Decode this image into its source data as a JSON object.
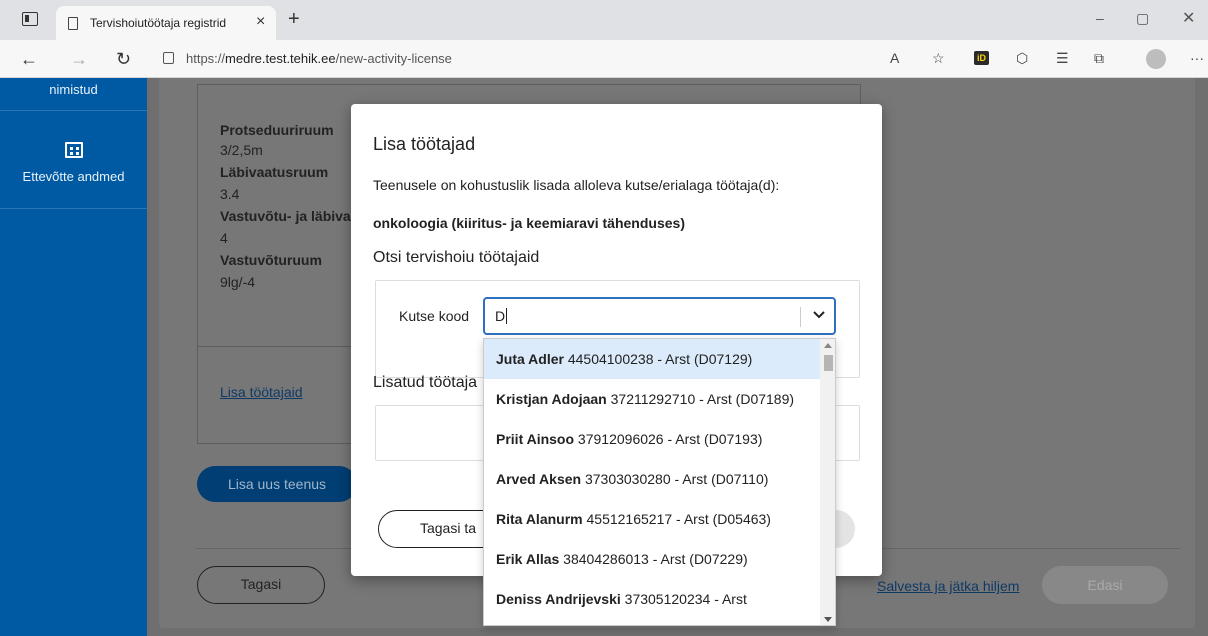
{
  "browser": {
    "tab_title": "Tervishoiutöötaja registrid",
    "tab_close": "×",
    "new_tab": "+",
    "url_prefix": "https://",
    "url_host": "medre.test.tehik.ee",
    "url_path": "/new-activity-license",
    "id_badge": "iD"
  },
  "sidebar": {
    "items": [
      {
        "label": "nimistud"
      },
      {
        "label": "Ettevõtte andmed",
        "icon": "building-icon"
      }
    ]
  },
  "background": {
    "fields": [
      {
        "label": "Protseduuriruum",
        "value": "3/2,5m"
      },
      {
        "label": "Läbivaatusruum",
        "value": "3.4"
      },
      {
        "label": "Vastuvõtu- ja läbiva",
        "value": "4"
      },
      {
        "label": "Vastuvõturuum",
        "value": "9lg/-4"
      }
    ],
    "add_staff_link": "Lisa töötajaid",
    "add_service_button": "Lisa uus teenus",
    "back_button": "Tagasi",
    "save_continue_link": "Salvesta ja jätka hiljem",
    "next_button": "Edasi"
  },
  "modal": {
    "title": "Lisa töötajad",
    "description": "Teenusele on kohustuslik lisada alloleva kutse/erialaga töötaja(d):",
    "specialty": "onkoloogia (kiiritus- ja keemiaravi tähenduses)",
    "search_heading": "Otsi tervishoiu töötajaid",
    "field_label": "Kutse kood",
    "field_value": "D",
    "added_heading": "Lisatud töötaja",
    "back_button": "Tagasi ta"
  },
  "dropdown": {
    "options": [
      {
        "name": "Juta Adler",
        "detail": " 44504100238 - Arst (D07129)"
      },
      {
        "name": "Kristjan Adojaan",
        "detail": " 37211292710 - Arst (D07189)"
      },
      {
        "name": "Priit Ainsoo",
        "detail": " 37912096026 - Arst (D07193)"
      },
      {
        "name": "Arved Aksen",
        "detail": " 37303030280 - Arst (D07110)"
      },
      {
        "name": "Rita Alanurm",
        "detail": " 45512165217 - Arst (D05463)"
      },
      {
        "name": "Erik Allas",
        "detail": " 38404286013 - Arst (D07229)"
      },
      {
        "name": "Deniss Andrijevski",
        "detail": " 37305120234 - Arst"
      }
    ]
  },
  "colors": {
    "sidebar": "#005aa3",
    "primary": "#2f6fbf",
    "highlight": "#dcebfb"
  }
}
